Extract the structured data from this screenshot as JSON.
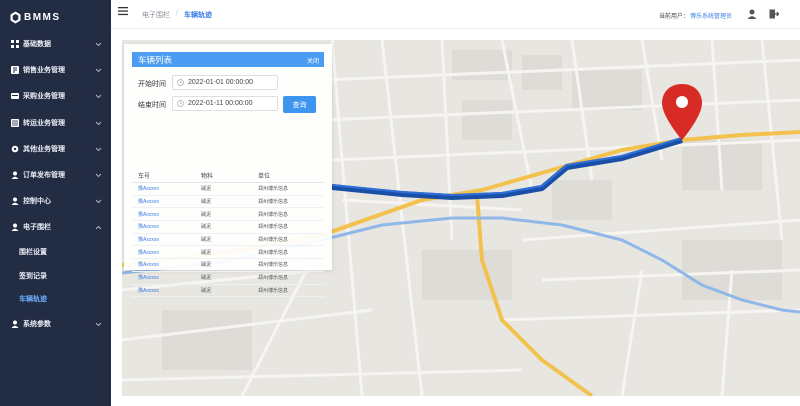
{
  "app": {
    "logo_text": "BMMS"
  },
  "sidebar": {
    "items": [
      {
        "label": "基础数据",
        "icon": "grid-icon"
      },
      {
        "label": "销售业务管理",
        "icon": "sales-icon"
      },
      {
        "label": "采购业务管理",
        "icon": "purchase-icon"
      },
      {
        "label": "转运业务管理",
        "icon": "transport-icon"
      },
      {
        "label": "其他业务管理",
        "icon": "settings-icon"
      },
      {
        "label": "订单发布管理",
        "icon": "user-icon"
      },
      {
        "label": "控制中心",
        "icon": "user-icon"
      },
      {
        "label": "电子围栏",
        "icon": "user-icon"
      }
    ],
    "sub_items": [
      {
        "label": "围栏设置"
      },
      {
        "label": "签到记录"
      },
      {
        "label": "车辆轨迹"
      }
    ],
    "last_item": {
      "label": "系统参数",
      "icon": "user-icon"
    }
  },
  "header": {
    "breadcrumb": [
      "电子围栏",
      "车辆轨迹"
    ],
    "separator": "/",
    "user_label": "当前用户：",
    "user_name": "博乐系统管理员"
  },
  "panel": {
    "title": "车辆列表",
    "close_label": "关闭",
    "start_label": "开始时间",
    "start_value": "2022-01-01 00:00:00",
    "end_label": "结束时间",
    "end_value": "2022-01-11 00:00:00",
    "query_label": "查询",
    "columns": [
      "车号",
      "物料",
      "单位"
    ],
    "rows": [
      [
        "豫Axxxxx",
        "碱泥",
        "郑州博乐信息"
      ],
      [
        "豫Axxxxx",
        "碱泥",
        "郑州博乐信息"
      ],
      [
        "豫Axxxxx",
        "碱泥",
        "郑州博乐信息"
      ],
      [
        "豫Axxxxx",
        "碱泥",
        "郑州博乐信息"
      ],
      [
        "豫Axxxxx",
        "碱泥",
        "郑州博乐信息"
      ],
      [
        "豫Axxxxx",
        "碱泥",
        "郑州博乐信息"
      ],
      [
        "豫Axxxxx",
        "碱泥",
        "郑州博乐信息"
      ],
      [
        "豫Axxxxx",
        "碱泥",
        "郑州博乐信息"
      ],
      [
        "豫Axxxxx",
        "碱泥",
        "郑州博乐信息"
      ]
    ]
  },
  "colors": {
    "sidebar_bg": "#222c43",
    "accent": "#3d95f0",
    "route": "#1f5fc4",
    "road_yellow": "#f2c14e",
    "road_blue": "#8fb7e8",
    "pin": "#d92b25"
  }
}
